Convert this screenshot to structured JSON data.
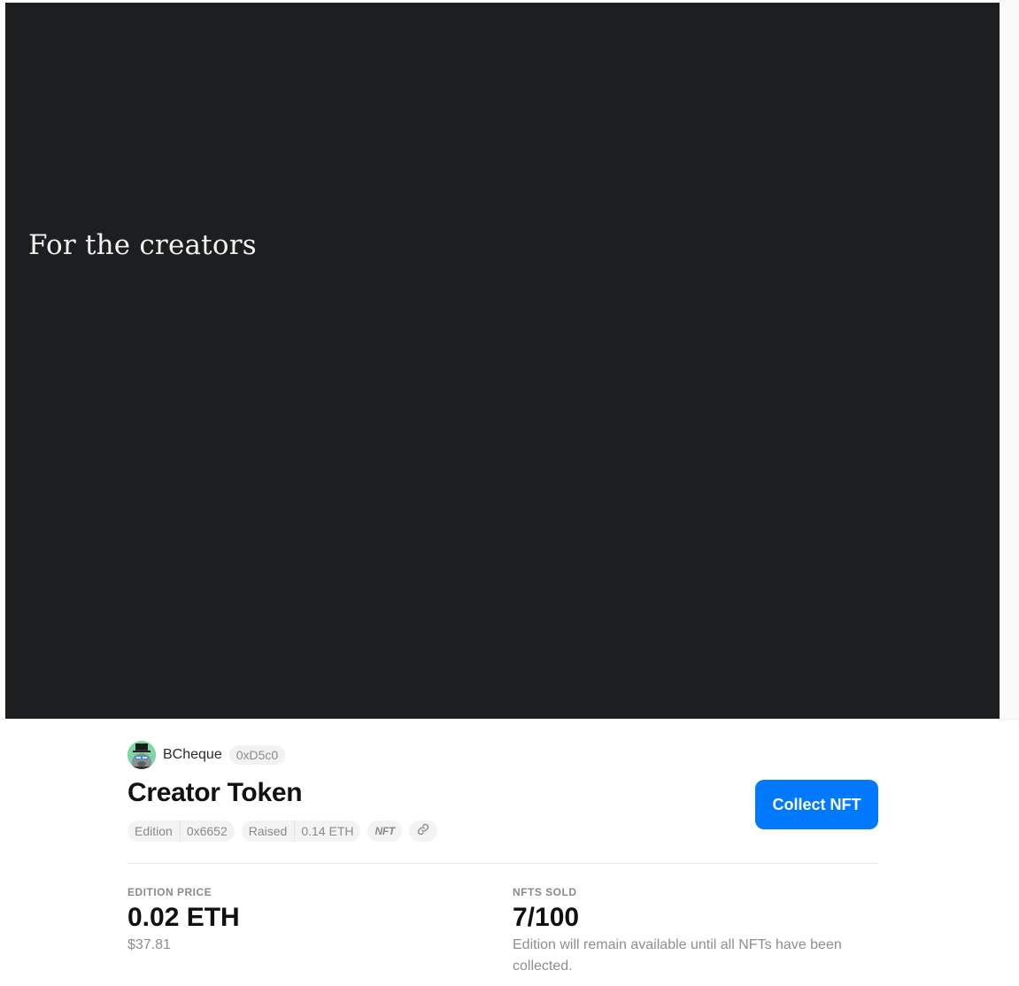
{
  "hero": {
    "text": "For the creators"
  },
  "creator": {
    "name": "BCheque",
    "address": "0xD5c0"
  },
  "token": {
    "title": "Creator Token",
    "tags": {
      "edition_label": "Edition",
      "edition_value": "0x6652",
      "raised_label": "Raised",
      "raised_value": "0.14 ETH",
      "nft_label": "NFT",
      "link_icon": "link-icon"
    }
  },
  "actions": {
    "collect_label": "Collect NFT"
  },
  "stats": {
    "price_label": "EDITION PRICE",
    "price_value": "0.02 ETH",
    "price_usd": "$37.81",
    "sold_label": "NFTS SOLD",
    "sold_value": "7/100",
    "sold_note": "Edition will remain available until all NFTs have been collected."
  },
  "colors": {
    "hero_background": "#1d1e20",
    "accent": "#0079ff",
    "avatar_background": "#7fd7a8"
  }
}
